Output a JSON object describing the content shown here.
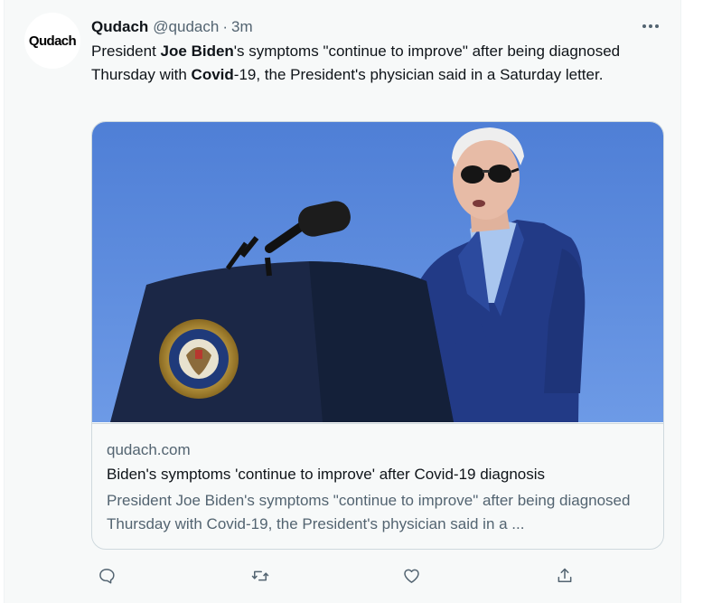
{
  "tweet": {
    "avatar": {
      "logo_text": "Qudach"
    },
    "author": {
      "name": "Qudach",
      "handle": "@qudach",
      "separator": "·",
      "time": "3m"
    },
    "more_icon": "more-horizontal-icon",
    "text": {
      "p1": "President ",
      "b1": "Joe Biden",
      "p2": "'s symptoms \"continue to improve\" after being diagnosed Thursday with ",
      "b2": "Covid",
      "p3": "-19, the President's physician said in a Saturday letter."
    },
    "card": {
      "domain": "qudach.com",
      "title": "Biden's symptoms 'continue to improve' after Covid-19 diagnosis",
      "description": "President Joe Biden's symptoms \"continue to improve\" after being diagnosed Thursday with Covid-19, the President's physician said in a ...",
      "image": "photo-president-at-podium"
    },
    "actions": [
      {
        "name": "reply",
        "icon": "reply-icon"
      },
      {
        "name": "retweet",
        "icon": "retweet-icon"
      },
      {
        "name": "like",
        "icon": "like-icon"
      },
      {
        "name": "share",
        "icon": "share-icon"
      }
    ],
    "colors": {
      "text": "#0f1419",
      "secondary": "#536471",
      "border": "#cfd9de",
      "background": "#f7f9f9"
    }
  }
}
